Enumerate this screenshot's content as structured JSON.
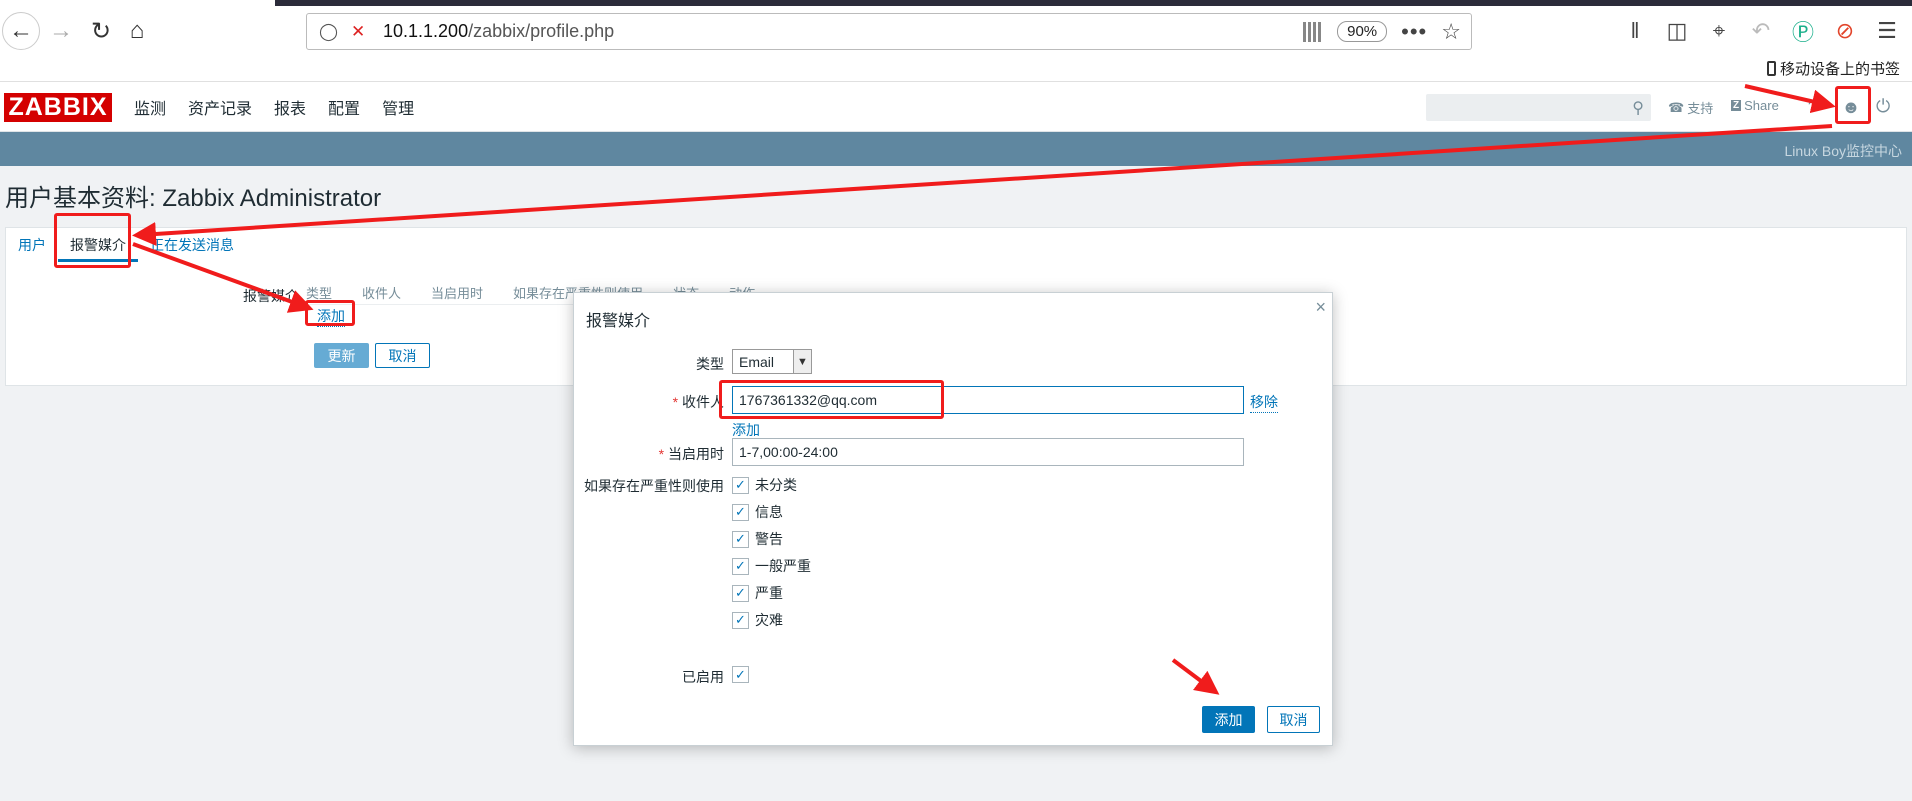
{
  "browser": {
    "url_host": "10.1.1.200",
    "url_path": "/zabbix/profile.php",
    "zoom": "90%",
    "mobile_bookmarks": "移动设备上的书签"
  },
  "header": {
    "logo": "ZABBIX",
    "menu": [
      "监测",
      "资产记录",
      "报表",
      "配置",
      "管理"
    ],
    "support": "支持",
    "share": "Share",
    "help": "?",
    "server_name": "Linux Boy监控中心"
  },
  "page": {
    "title": "用户基本资料: Zabbix Administrator",
    "tabs": [
      "用户",
      "报警媒介",
      "正在发送消息"
    ],
    "media_label": "报警媒介",
    "table_headers": [
      "类型",
      "收件人",
      "当启用时",
      "如果存在严重性则使用",
      "状态",
      "动作"
    ],
    "add_link": "添加",
    "update_button": "更新",
    "cancel_button": "取消"
  },
  "modal": {
    "title": "报警媒介",
    "type_label": "类型",
    "type_value": "Email",
    "sendto_label": "收件人",
    "sendto_value": "1767361332@qq.com",
    "remove_link": "移除",
    "add_link": "添加",
    "period_label": "当启用时",
    "period_value": "1-7,00:00-24:00",
    "severity_label": "如果存在严重性则使用",
    "severities": [
      {
        "label": "未分类",
        "checked": true
      },
      {
        "label": "信息",
        "checked": true
      },
      {
        "label": "警告",
        "checked": true
      },
      {
        "label": "一般严重",
        "checked": true
      },
      {
        "label": "严重",
        "checked": true
      },
      {
        "label": "灾难",
        "checked": true
      }
    ],
    "enabled_label": "已启用",
    "add_button": "添加",
    "cancel_button": "取消"
  },
  "colors": {
    "accent": "#0275b8",
    "logo_red": "#d40000",
    "annotation_red": "#f01c1c",
    "header_strip": "#5f87a0"
  }
}
